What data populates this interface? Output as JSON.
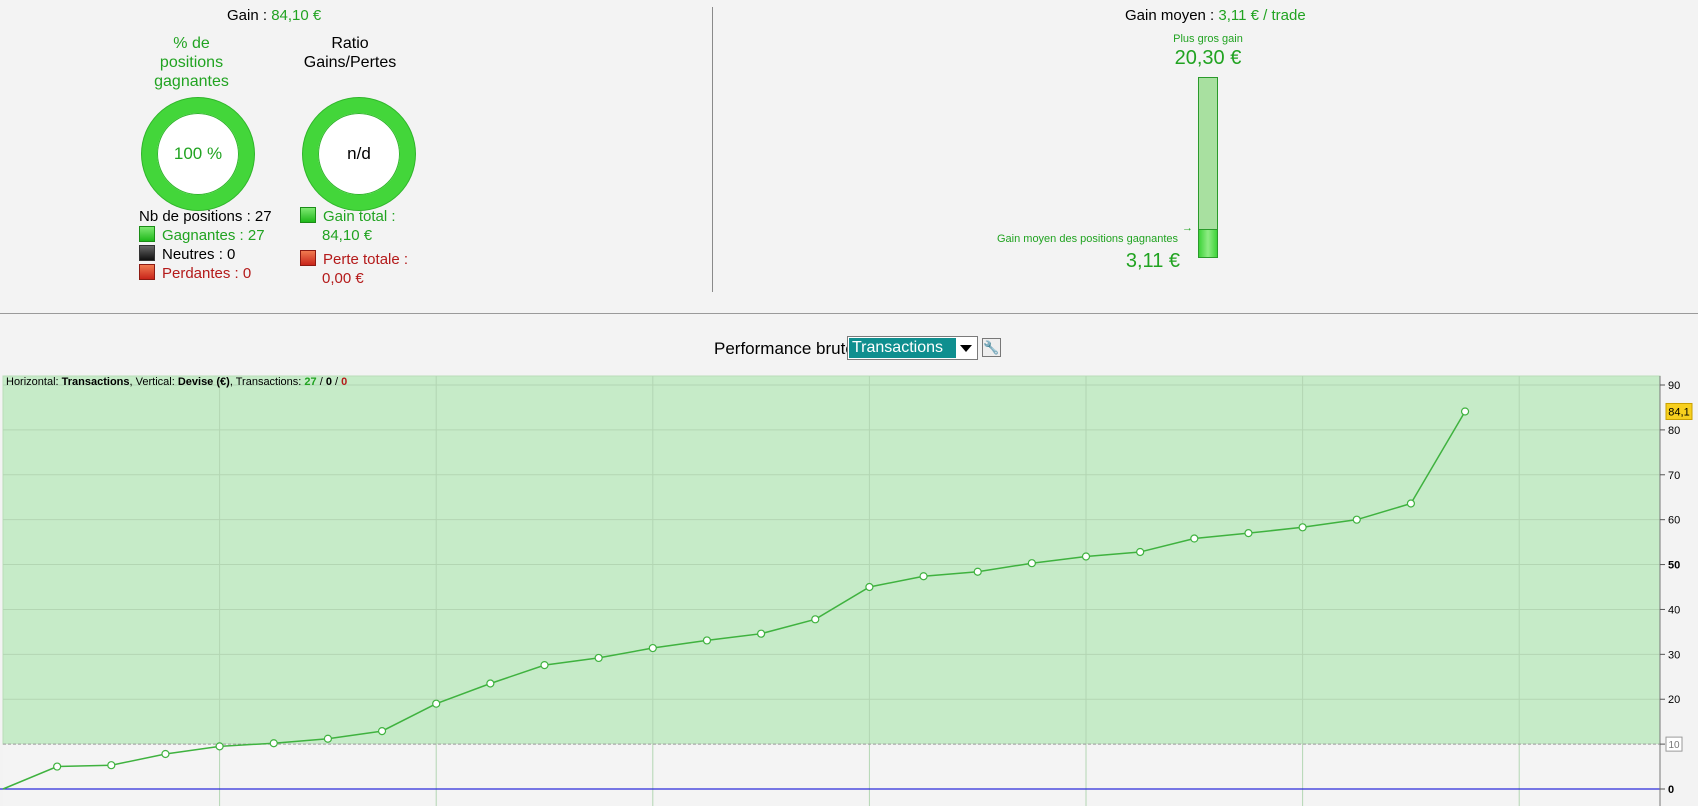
{
  "summary": {
    "gain_label": "Gain :",
    "gain_value": "84,10 €",
    "gain_moyen_label": "Gain moyen :",
    "gain_moyen_value": "3,11 € / trade"
  },
  "win_gauge": {
    "title_lines": [
      "% de",
      "positions",
      "gagnantes"
    ],
    "value": "100 %",
    "fill_fraction": 1.0
  },
  "ratio_gauge": {
    "title_lines": [
      "Ratio",
      "Gains/Pertes"
    ],
    "value": "n/d"
  },
  "positions": {
    "total": "Nb de positions : 27",
    "gagnantes": "Gagnantes : 27",
    "neutres": "Neutres : 0",
    "perdantes": "Perdantes : 0"
  },
  "totals": {
    "gain_total_label": "Gain total :",
    "gain_total_value": "84,10 €",
    "perte_totale_label": "Perte totale :",
    "perte_totale_value": "0,00 €"
  },
  "gain_bar": {
    "max_label": "Plus gros gain",
    "max_value": "20,30 €",
    "avg_label": "Gain moyen des positions gagnantes",
    "avg_value": "3,11 €",
    "avg_over_max_fraction": 0.153
  },
  "performance": {
    "label": "Performance brute",
    "selected_option": "Transactions"
  },
  "chart_info": {
    "horizontal_label": "Horizontal:",
    "horizontal_value": "Transactions",
    "vertical_label": "Vertical:",
    "vertical_value": "Devise (€)",
    "transactions_label": "Transactions:",
    "wins": "27",
    "neutral": "0",
    "losses": "0"
  },
  "colors": {
    "green_text": "#21a321",
    "red_text": "#b41a1a",
    "chart_area": "#c6ebc8",
    "series_line": "#3fb23f",
    "zero_line": "#2a2adb",
    "last_value_badge": "#f7cf1e"
  },
  "chart_data": {
    "type": "line",
    "x": [
      0,
      1,
      2,
      3,
      4,
      5,
      6,
      7,
      8,
      9,
      10,
      11,
      12,
      13,
      14,
      15,
      16,
      17,
      18,
      19,
      20,
      21,
      22,
      23,
      24,
      25,
      26,
      27
    ],
    "series": [
      {
        "values": [
          0,
          5.0,
          5.3,
          7.8,
          9.5,
          10.2,
          11.2,
          12.9,
          19.0,
          23.5,
          27.6,
          29.2,
          31.4,
          33.1,
          34.6,
          37.8,
          45.0,
          47.4,
          48.4,
          50.3,
          51.8,
          52.8,
          55.8,
          57.0,
          58.3,
          60.0,
          63.6,
          84.1
        ]
      }
    ],
    "xlim": [
      0,
      30.6
    ],
    "ylim": [
      0,
      90
    ],
    "yticks": [
      0,
      10,
      20,
      30,
      40,
      50,
      60,
      70,
      80,
      90
    ],
    "threshold": 10,
    "last_value_label": "84,1",
    "grid": true
  }
}
